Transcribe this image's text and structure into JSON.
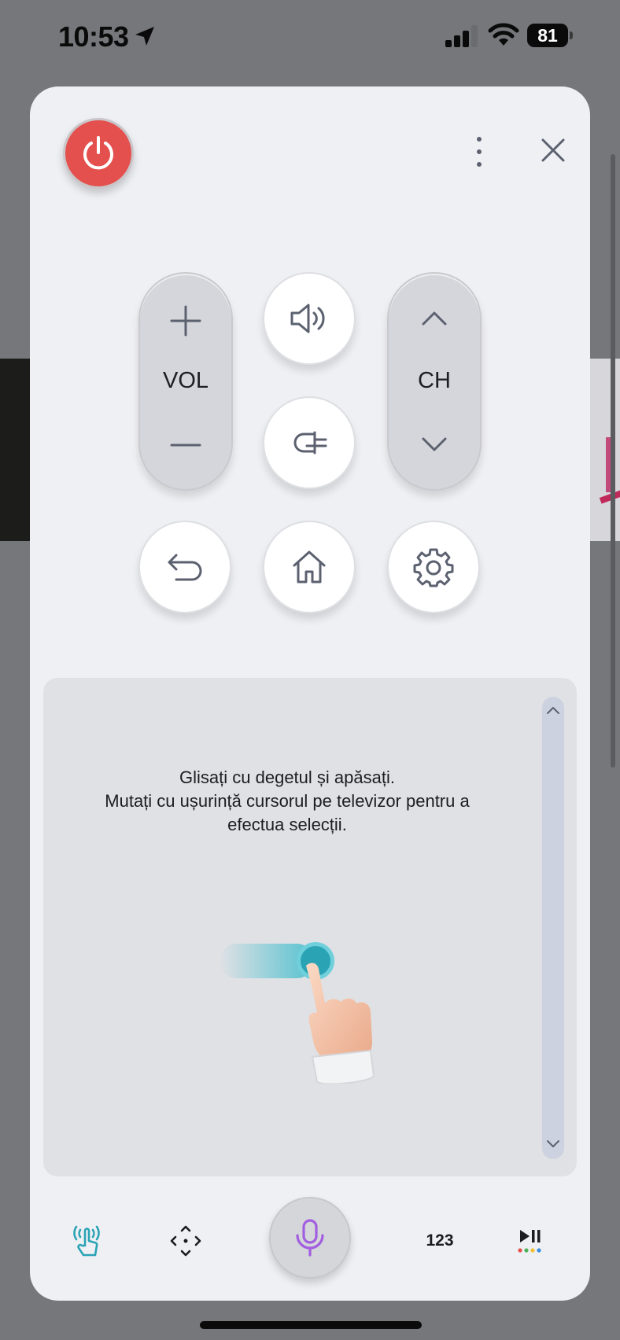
{
  "status_bar": {
    "time": "10:53",
    "battery": "81",
    "icons": [
      "location-arrow-icon",
      "cellular-signal-icon",
      "wifi-icon",
      "battery-icon"
    ]
  },
  "remote": {
    "power_icon": "power-icon",
    "more_icon": "more-vertical-icon",
    "close_icon": "close-icon",
    "volume": {
      "label": "VOL",
      "up_icon": "plus-icon",
      "down_icon": "minus-icon"
    },
    "channel": {
      "label": "CH",
      "up_icon": "chevron-up-icon",
      "down_icon": "chevron-down-icon"
    },
    "mute_icon": "speaker-icon",
    "input_icon": "input-plug-icon",
    "back_icon": "back-arrow-icon",
    "home_icon": "home-icon",
    "settings_icon": "gear-icon"
  },
  "touchpad": {
    "line1": "Glisați cu degetul și apăsați.",
    "line2": "Mutați cu ușurință cursorul pe televizor pentru a",
    "line3": "efectua selecții.",
    "illustration": "swipe-hand-illustration"
  },
  "bottom_bar": {
    "touch_icon": "touch-gesture-icon",
    "dpad_icon": "dpad-arrows-icon",
    "mic_icon": "microphone-icon",
    "numbers_label": "123",
    "media_icon": "play-pause-icon"
  },
  "colors": {
    "power": "#e4504d",
    "mic": "#a25ee0",
    "touch_accent": "#2aa4b5",
    "sheet_bg": "#eff0f4"
  }
}
